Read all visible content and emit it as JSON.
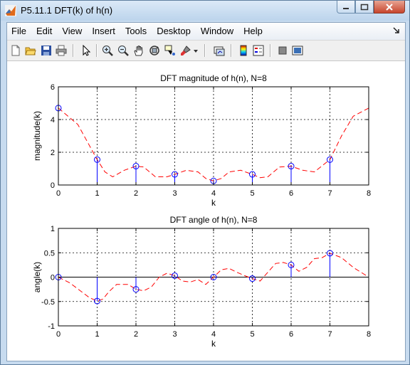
{
  "window": {
    "title": "P5.11.1 DFT(k) of h(n)"
  },
  "menu": [
    "File",
    "Edit",
    "View",
    "Insert",
    "Tools",
    "Desktop",
    "Window",
    "Help"
  ],
  "toolbar": [
    "new-figure-icon",
    "open-file-icon",
    "save-icon",
    "print-icon",
    "edit-plot-arrow-icon",
    "zoom-in-icon",
    "zoom-out-icon",
    "pan-hand-icon",
    "rotate-3d-icon",
    "data-cursor-icon",
    "brush-icon",
    "brush-dropdown-icon",
    "link-plot-icon",
    "colorbar-icon",
    "legend-icon",
    "hide-plot-tools-icon",
    "show-plot-tools-icon"
  ],
  "colors": {
    "stem": "#0000ff",
    "marker": "#0000ff",
    "curve": "#ff0000",
    "grid": "#000000"
  },
  "chart_data": [
    {
      "type": "stem",
      "title": "DFT magnitude of h(n), N=8",
      "xlabel": "k",
      "ylabel": "magnitude(k)",
      "xlim": [
        0,
        8
      ],
      "ylim": [
        0,
        6
      ],
      "xticks": [
        "0",
        "1",
        "2",
        "3",
        "4",
        "5",
        "6",
        "7",
        "8"
      ],
      "yticks": [
        "0",
        "2",
        "4",
        "6"
      ],
      "grid": true,
      "stems": {
        "x": [
          0,
          1,
          2,
          3,
          4,
          5,
          6,
          7
        ],
        "y": [
          4.7,
          1.55,
          1.15,
          0.65,
          0.25,
          0.65,
          1.15,
          1.55
        ]
      },
      "curve": {
        "style": "dashed",
        "x": [
          0,
          0.5,
          1,
          1.2,
          1.4,
          1.7,
          2,
          2.2,
          2.5,
          2.8,
          3,
          3.3,
          3.6,
          3.8,
          4,
          4.2,
          4.4,
          4.7,
          5,
          5.2,
          5.4,
          5.7,
          6,
          6.3,
          6.6,
          7,
          7.3,
          7.6,
          8
        ],
        "y": [
          4.7,
          3.7,
          1.55,
          0.8,
          0.5,
          0.9,
          1.15,
          1.1,
          0.5,
          0.5,
          0.65,
          0.9,
          0.8,
          0.4,
          0.25,
          0.4,
          0.8,
          0.9,
          0.65,
          0.45,
          0.5,
          1.1,
          1.15,
          0.9,
          0.8,
          1.55,
          3.0,
          4.2,
          4.7
        ]
      }
    },
    {
      "type": "stem",
      "title": "DFT angle of h(n), N=8",
      "xlabel": "k",
      "ylabel": "angle(k)",
      "xlim": [
        0,
        8
      ],
      "ylim": [
        -1,
        1
      ],
      "xticks": [
        "0",
        "1",
        "2",
        "3",
        "4",
        "5",
        "6",
        "7",
        "8"
      ],
      "yticks": [
        "-1",
        "-0.5",
        "0",
        "0.5",
        "1"
      ],
      "grid": true,
      "stems": {
        "x": [
          0,
          1,
          2,
          3,
          4,
          5,
          6,
          7
        ],
        "y": [
          0,
          -0.49,
          -0.25,
          0.03,
          0,
          -0.03,
          0.25,
          0.49
        ]
      },
      "curve": {
        "style": "dashed",
        "x": [
          0,
          0.3,
          0.6,
          0.8,
          1,
          1.15,
          1.3,
          1.5,
          1.8,
          2,
          2.2,
          2.4,
          2.6,
          2.8,
          3,
          3.2,
          3.4,
          3.6,
          3.8,
          4,
          4.2,
          4.4,
          4.6,
          4.8,
          5,
          5.2,
          5.4,
          5.6,
          5.8,
          6,
          6.2,
          6.4,
          6.6,
          6.8,
          7,
          7.3,
          7.6,
          8
        ],
        "y": [
          0,
          -0.12,
          -0.3,
          -0.42,
          -0.49,
          -0.45,
          -0.3,
          -0.15,
          -0.15,
          -0.25,
          -0.28,
          -0.2,
          0.0,
          0.08,
          0.03,
          -0.08,
          -0.1,
          -0.05,
          -0.15,
          0.0,
          0.15,
          0.18,
          0.1,
          0.03,
          -0.03,
          -0.08,
          0.1,
          0.28,
          0.3,
          0.25,
          0.12,
          0.2,
          0.38,
          0.4,
          0.49,
          0.4,
          0.2,
          0.0
        ]
      }
    }
  ]
}
